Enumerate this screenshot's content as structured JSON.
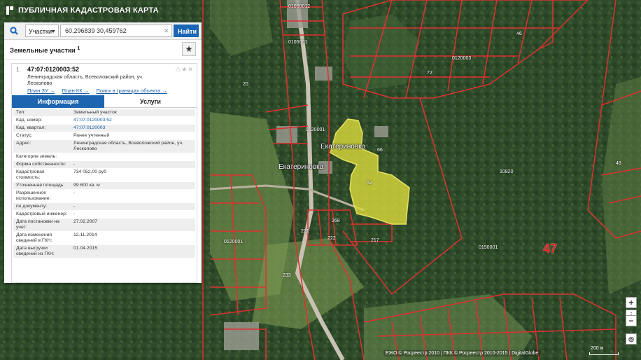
{
  "app": {
    "title": "ПУБЛИЧНАЯ КАДАСТРОВАЯ КАРТА"
  },
  "search": {
    "type_selected": "Участки",
    "query": "60,296839 30,459762",
    "find_label": "Найти"
  },
  "results": {
    "title": "Земельные участки",
    "count": "1"
  },
  "parcel": {
    "index": "1.",
    "cad_number": "47:07:0120003:52",
    "address": "Ленинградская область, Всеволожский район, уч. Лесколово",
    "links": [
      "План ЗУ →",
      "План КК →",
      "Поиск в границах объекта →"
    ],
    "tabs": [
      "Информация",
      "Услуги"
    ],
    "info": [
      {
        "k": "Тип:",
        "v": "Земельный участок"
      },
      {
        "k": "Кад. номер:",
        "v": "47:07:0120003:52",
        "link": true
      },
      {
        "k": "Кад. квартал:",
        "v": "47:07:0120003",
        "link": true
      },
      {
        "k": "Статус:",
        "v": "Ранее учтенный"
      },
      {
        "k": "Адрес:",
        "v": "Ленинградская область, Всеволожский район, уч. Лесколово"
      },
      {
        "k": "Категория земель:",
        "v": ""
      },
      {
        "k": "Форма собственности:",
        "v": "-"
      },
      {
        "k": "Кадастровая стоимость:",
        "v": "734 052,00 руб"
      },
      {
        "k": "Уточненная площадь:",
        "v": "99 600 кв. м"
      },
      {
        "k": "Разрешенное использование:",
        "v": "-"
      },
      {
        "k": "по документу:",
        "v": "-"
      },
      {
        "k": "Кадастровый инженер:",
        "v": "-"
      },
      {
        "k": "Дата постановки на учет:",
        "v": "27.02.2007"
      },
      {
        "k": "Дата изменения сведений в ГКН:",
        "v": "12.11.2014"
      },
      {
        "k": "Дата выгрузки сведений из ГКН:",
        "v": "01.04.2015"
      }
    ]
  },
  "map": {
    "labels": [
      {
        "t": "01050012"
      },
      {
        "t": "0105001"
      },
      {
        "t": "0120003"
      },
      {
        "t": "0120001"
      },
      {
        "t": "0150001"
      },
      {
        "t": "0120001"
      },
      {
        "t": "47"
      },
      {
        "t": "72"
      },
      {
        "t": "46"
      },
      {
        "t": "20"
      },
      {
        "t": "52"
      },
      {
        "t": "66"
      },
      {
        "t": "221"
      },
      {
        "t": "222"
      },
      {
        "t": "217"
      },
      {
        "t": "268"
      },
      {
        "t": "233"
      },
      {
        "t": "10820"
      },
      {
        "t": "48"
      }
    ],
    "town1": "Екатериновка",
    "town2": "Екатериновка",
    "region": "47",
    "zoom_in": "+",
    "zoom_out": "−",
    "scale": "200 м",
    "attribution": "ЕЖО © Росреестр 2010 | ПКК © Росреестр 2010-2015 | DigitalGlobe"
  },
  "colors": {
    "accent": "#1e65b1",
    "parcel_fill": "#d8d83a",
    "cad_line": "#e03030"
  }
}
